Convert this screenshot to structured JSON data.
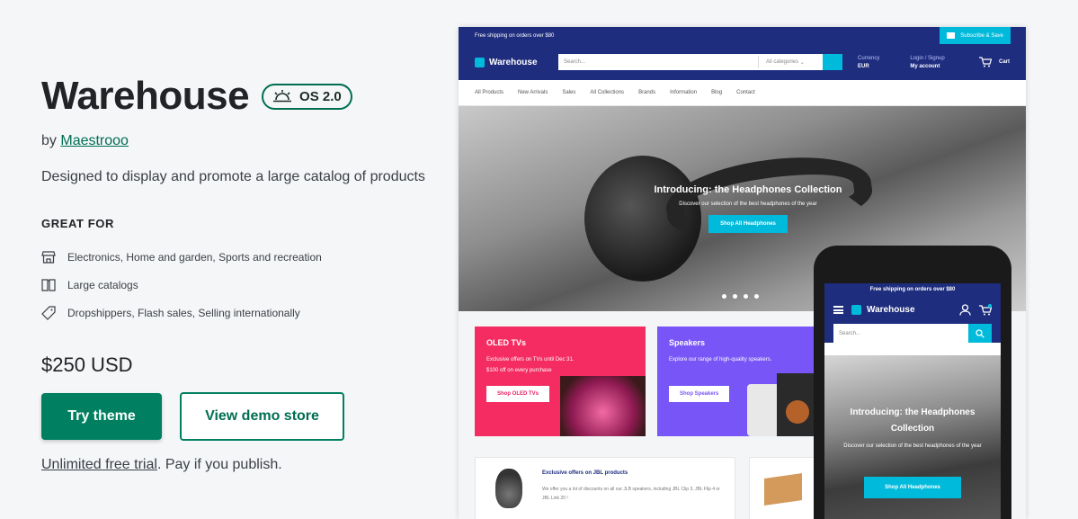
{
  "theme": {
    "title": "Warehouse",
    "badge": "OS 2.0",
    "by_prefix": "by",
    "author": "Maestrooo",
    "description": "Designed to display and promote a large catalog of products",
    "great_for_heading": "GREAT FOR",
    "features": [
      {
        "icon": "store-icon",
        "label": "Electronics, Home and garden, Sports and recreation"
      },
      {
        "icon": "book-icon",
        "label": "Large catalogs"
      },
      {
        "icon": "tag-icon",
        "label": "Dropshippers, Flash sales, Selling internationally"
      }
    ],
    "price": "$250 USD",
    "try_button": "Try theme",
    "demo_button": "View demo store",
    "trial_link": "Unlimited free trial",
    "trial_suffix": ". Pay if you publish."
  },
  "desktop_preview": {
    "announcement": "Free shipping on orders over $80",
    "subscribe": "Subscribe & Save",
    "store_name": "Warehouse",
    "search_placeholder": "Search...",
    "category_select": "All categories",
    "currency_label": "Currency",
    "currency_value": "EUR",
    "account_label": "Login / Signup",
    "account_value": "My account",
    "cart_count": "0",
    "cart_label": "Cart",
    "nav": [
      "All Products",
      "New Arrivals",
      "Sales",
      "All Collections",
      "Brands",
      "Information",
      "Blog",
      "Contact"
    ],
    "hero_title": "Introducing: the Headphones Collection",
    "hero_subtitle": "Discover our selection of the best headphones of the year",
    "hero_button": "Shop All Headphones",
    "promo_oled": {
      "title": "OLED TVs",
      "line1": "Exclusive offers on TVs until Dec 31.",
      "line2": "$100 off on every purchase",
      "button": "Shop OLED TVs"
    },
    "promo_speakers": {
      "title": "Speakers",
      "line1": "Explore our range of high-quality speakers.",
      "button": "Shop Speakers"
    },
    "jbl_card": {
      "title": "Exclusive offers on JBL products",
      "text": "We offer you a lot of discounts on all our JLB speakers, including JBL Clip 3, JBL Flip 4 or JBL Link 20 !"
    }
  },
  "mobile_preview": {
    "announcement": "Free shipping on orders over $80",
    "store_name": "Warehouse",
    "cart_count": "0",
    "search_placeholder": "Search...",
    "hero_title": "Introducing: the Headphones Collection",
    "hero_subtitle": "Discover our selection of the best headphones of the year",
    "hero_button": "Shop All Headphones"
  },
  "colors": {
    "brand_green": "#008060",
    "store_navy": "#1e2d7d",
    "store_cyan": "#00badb",
    "promo_pink": "#f42c61",
    "promo_purple": "#7755f6"
  }
}
